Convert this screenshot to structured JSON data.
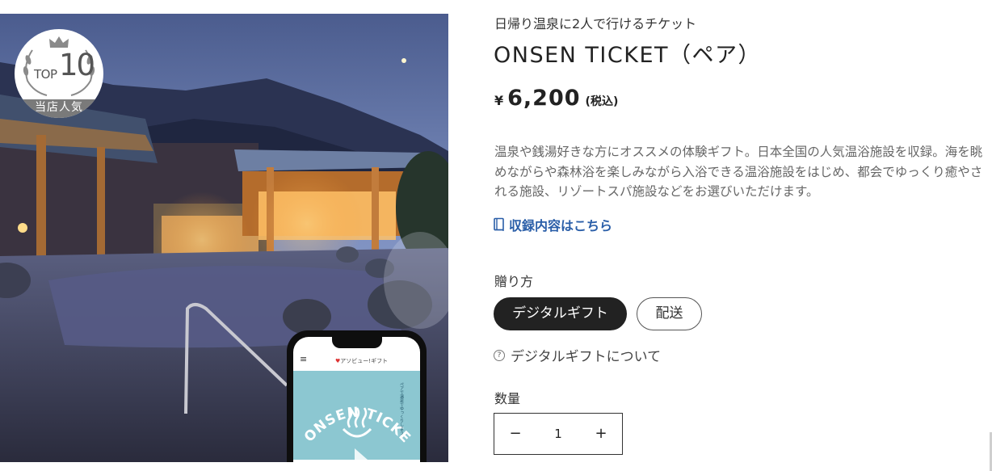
{
  "badge": {
    "top_label": "TOP",
    "rank": "10",
    "caption": "当店人気"
  },
  "phone": {
    "menu_icon": "hamburger-icon",
    "brand": "アソビュー!ギフト",
    "ticket_title": "ONSEN TICKET",
    "ticket_side_text": "ペアで温泉でゆっくりしよう"
  },
  "product": {
    "eyebrow": "日帰り温泉に2人で行けるチケット",
    "title": "ONSEN TICKET（ペア）",
    "price": {
      "currency": "¥",
      "amount": "6,200",
      "tax_note": "(税込)"
    },
    "description": "温泉や銭湯好きな方にオススメの体験ギフト。日本全国の人気温浴施設を収録。海を眺めながらや森林浴を楽しみながら入浴できる温浴施設をはじめ、都会でゆっくり癒やされる施設、リゾートスパ施設などをお選びいただけます。",
    "contents_link": {
      "icon": "book-icon",
      "label": "収録内容はこちら"
    }
  },
  "delivery": {
    "label": "贈り方",
    "options": [
      {
        "label": "デジタルギフト",
        "selected": true
      },
      {
        "label": "配送",
        "selected": false
      }
    ],
    "about_link": {
      "icon": "help-icon",
      "label": "デジタルギフトについて"
    }
  },
  "quantity": {
    "label": "数量",
    "value": "1",
    "minus": "−",
    "plus": "+"
  },
  "colors": {
    "link": "#2a5ea8",
    "selected_pill": "#222222",
    "badge_band": "#7a7a7a"
  }
}
